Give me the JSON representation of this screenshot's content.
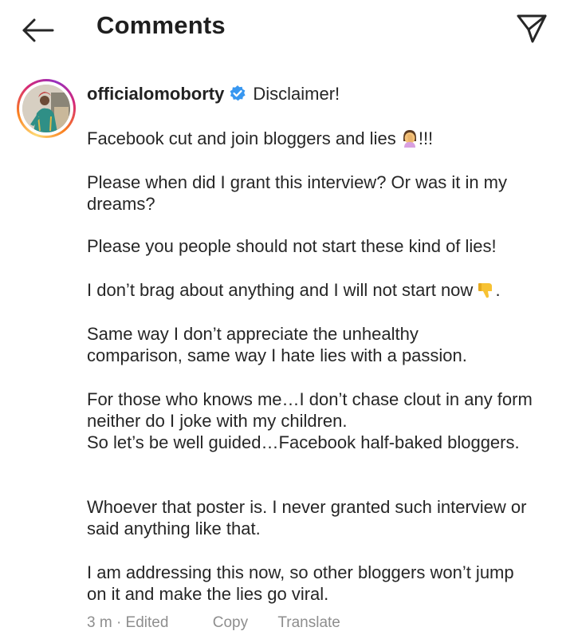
{
  "header": {
    "title": "Comments",
    "back_icon": "arrow-left-icon",
    "send_icon": "paper-plane-icon"
  },
  "comment": {
    "username": "officialomoborty",
    "verified_icon": "verified-badge-icon",
    "first_line_text": "Disclaimer!",
    "lines": [
      "Facebook cut and join bloggers and lies",
      "!!!",
      "Please when did I grant this interview? Or was it in my dreams?",
      "Please you people should not start these kind of lies!",
      "I don’t brag about anything and I will not start now",
      ".",
      "Same way I don’t appreciate the unhealthy comparison, same way I hate lies with a passion.",
      "For those who knows me…I don’t chase clout in any form neither do I joke with my children.",
      "So let’s be well guided…Facebook half-baked bloggers.",
      "Whoever that poster is. I never granted such interview or said anything like that.",
      "I am addressing this now, so other bloggers won’t jump on it and make the lies go viral."
    ],
    "emojis": [
      "woman-facepalming-emoji",
      "thumbs-down-emoji"
    ]
  },
  "footer": {
    "meta": "3 m · Edited",
    "copy_label": "Copy",
    "translate_label": "Translate"
  },
  "colors": {
    "text": "#262626",
    "muted": "#8e8e8e",
    "verified": "#3897f0"
  }
}
